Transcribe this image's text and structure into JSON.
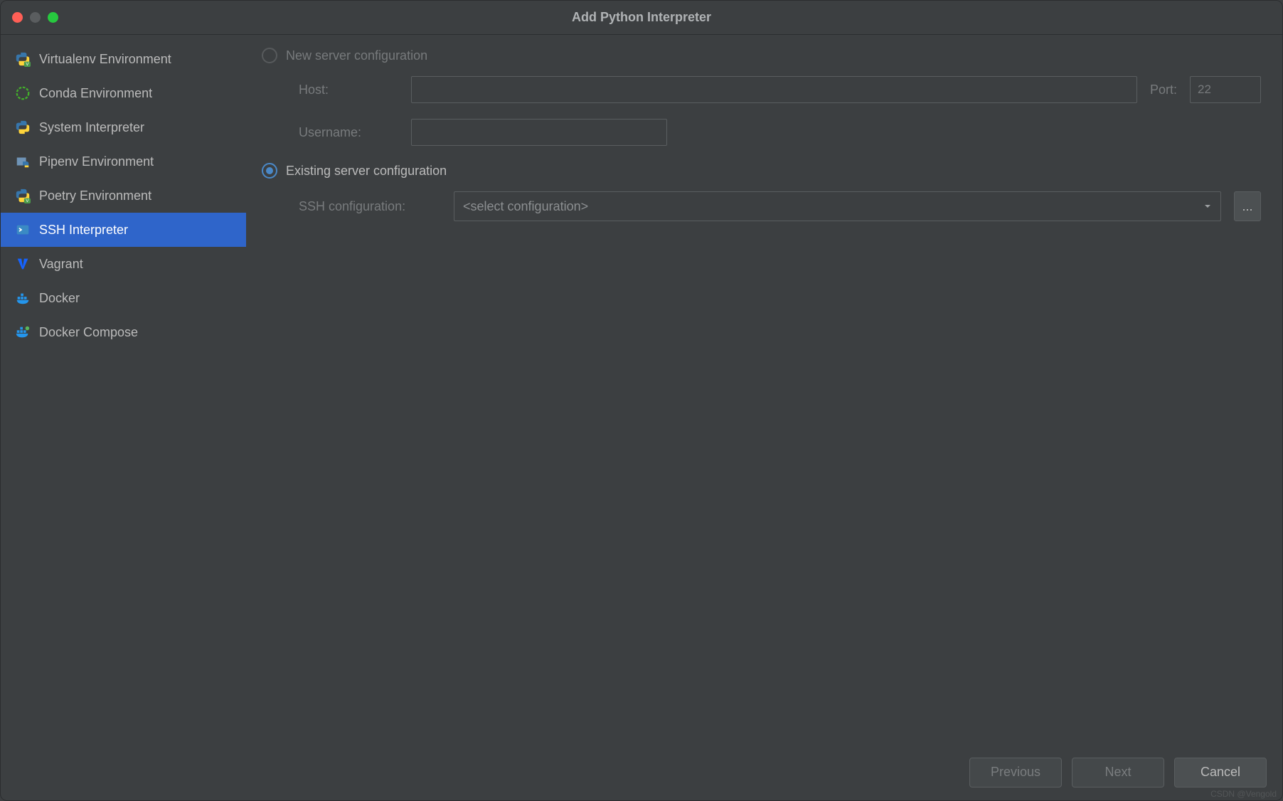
{
  "title": "Add Python Interpreter",
  "sidebar": {
    "items": [
      {
        "label": "Virtualenv Environment",
        "icon": "python-venv-icon",
        "selected": false
      },
      {
        "label": "Conda Environment",
        "icon": "conda-icon",
        "selected": false
      },
      {
        "label": "System Interpreter",
        "icon": "python-icon",
        "selected": false
      },
      {
        "label": "Pipenv Environment",
        "icon": "pipenv-icon",
        "selected": false
      },
      {
        "label": "Poetry Environment",
        "icon": "poetry-icon",
        "selected": false
      },
      {
        "label": "SSH Interpreter",
        "icon": "ssh-icon",
        "selected": true
      },
      {
        "label": "Vagrant",
        "icon": "vagrant-icon",
        "selected": false
      },
      {
        "label": "Docker",
        "icon": "docker-icon",
        "selected": false
      },
      {
        "label": "Docker Compose",
        "icon": "docker-compose-icon",
        "selected": false
      }
    ]
  },
  "form": {
    "new_server": {
      "radio_label": "New server configuration",
      "selected": false,
      "enabled": false,
      "host_label": "Host:",
      "host_value": "",
      "port_label": "Port:",
      "port_value": "22",
      "username_label": "Username:",
      "username_value": ""
    },
    "existing_server": {
      "radio_label": "Existing server configuration",
      "selected": true,
      "ssh_config_label": "SSH configuration:",
      "ssh_config_placeholder": "<select configuration>",
      "browse_label": "..."
    }
  },
  "footer": {
    "previous": "Previous",
    "next": "Next",
    "cancel": "Cancel",
    "previous_enabled": false,
    "next_enabled": false,
    "cancel_enabled": true
  },
  "watermark": "CSDN @Vengold"
}
